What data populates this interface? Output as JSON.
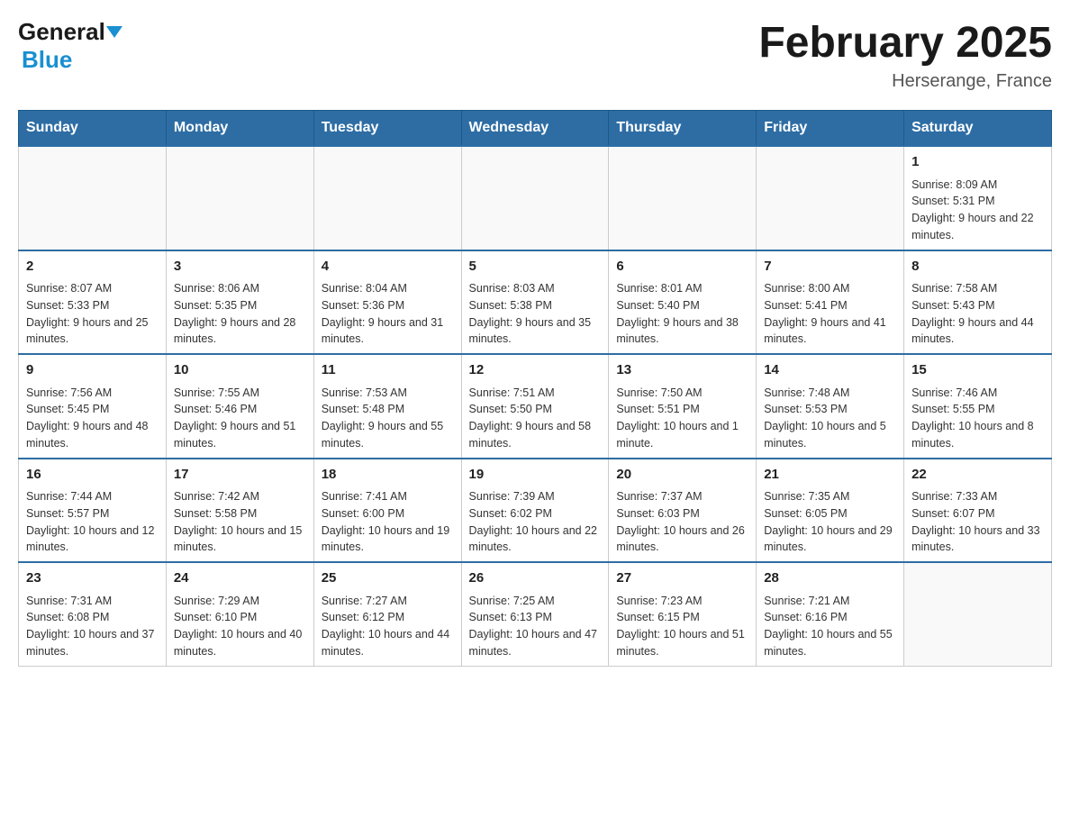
{
  "header": {
    "month_title": "February 2025",
    "location": "Herserange, France",
    "logo_general": "General",
    "logo_blue": "Blue"
  },
  "weekdays": [
    "Sunday",
    "Monday",
    "Tuesday",
    "Wednesday",
    "Thursday",
    "Friday",
    "Saturday"
  ],
  "weeks": [
    {
      "days": [
        {
          "num": "",
          "info": "",
          "empty": true
        },
        {
          "num": "",
          "info": "",
          "empty": true
        },
        {
          "num": "",
          "info": "",
          "empty": true
        },
        {
          "num": "",
          "info": "",
          "empty": true
        },
        {
          "num": "",
          "info": "",
          "empty": true
        },
        {
          "num": "",
          "info": "",
          "empty": true
        },
        {
          "num": "1",
          "info": "Sunrise: 8:09 AM\nSunset: 5:31 PM\nDaylight: 9 hours and 22 minutes.",
          "empty": false
        }
      ]
    },
    {
      "days": [
        {
          "num": "2",
          "info": "Sunrise: 8:07 AM\nSunset: 5:33 PM\nDaylight: 9 hours and 25 minutes.",
          "empty": false
        },
        {
          "num": "3",
          "info": "Sunrise: 8:06 AM\nSunset: 5:35 PM\nDaylight: 9 hours and 28 minutes.",
          "empty": false
        },
        {
          "num": "4",
          "info": "Sunrise: 8:04 AM\nSunset: 5:36 PM\nDaylight: 9 hours and 31 minutes.",
          "empty": false
        },
        {
          "num": "5",
          "info": "Sunrise: 8:03 AM\nSunset: 5:38 PM\nDaylight: 9 hours and 35 minutes.",
          "empty": false
        },
        {
          "num": "6",
          "info": "Sunrise: 8:01 AM\nSunset: 5:40 PM\nDaylight: 9 hours and 38 minutes.",
          "empty": false
        },
        {
          "num": "7",
          "info": "Sunrise: 8:00 AM\nSunset: 5:41 PM\nDaylight: 9 hours and 41 minutes.",
          "empty": false
        },
        {
          "num": "8",
          "info": "Sunrise: 7:58 AM\nSunset: 5:43 PM\nDaylight: 9 hours and 44 minutes.",
          "empty": false
        }
      ]
    },
    {
      "days": [
        {
          "num": "9",
          "info": "Sunrise: 7:56 AM\nSunset: 5:45 PM\nDaylight: 9 hours and 48 minutes.",
          "empty": false
        },
        {
          "num": "10",
          "info": "Sunrise: 7:55 AM\nSunset: 5:46 PM\nDaylight: 9 hours and 51 minutes.",
          "empty": false
        },
        {
          "num": "11",
          "info": "Sunrise: 7:53 AM\nSunset: 5:48 PM\nDaylight: 9 hours and 55 minutes.",
          "empty": false
        },
        {
          "num": "12",
          "info": "Sunrise: 7:51 AM\nSunset: 5:50 PM\nDaylight: 9 hours and 58 minutes.",
          "empty": false
        },
        {
          "num": "13",
          "info": "Sunrise: 7:50 AM\nSunset: 5:51 PM\nDaylight: 10 hours and 1 minute.",
          "empty": false
        },
        {
          "num": "14",
          "info": "Sunrise: 7:48 AM\nSunset: 5:53 PM\nDaylight: 10 hours and 5 minutes.",
          "empty": false
        },
        {
          "num": "15",
          "info": "Sunrise: 7:46 AM\nSunset: 5:55 PM\nDaylight: 10 hours and 8 minutes.",
          "empty": false
        }
      ]
    },
    {
      "days": [
        {
          "num": "16",
          "info": "Sunrise: 7:44 AM\nSunset: 5:57 PM\nDaylight: 10 hours and 12 minutes.",
          "empty": false
        },
        {
          "num": "17",
          "info": "Sunrise: 7:42 AM\nSunset: 5:58 PM\nDaylight: 10 hours and 15 minutes.",
          "empty": false
        },
        {
          "num": "18",
          "info": "Sunrise: 7:41 AM\nSunset: 6:00 PM\nDaylight: 10 hours and 19 minutes.",
          "empty": false
        },
        {
          "num": "19",
          "info": "Sunrise: 7:39 AM\nSunset: 6:02 PM\nDaylight: 10 hours and 22 minutes.",
          "empty": false
        },
        {
          "num": "20",
          "info": "Sunrise: 7:37 AM\nSunset: 6:03 PM\nDaylight: 10 hours and 26 minutes.",
          "empty": false
        },
        {
          "num": "21",
          "info": "Sunrise: 7:35 AM\nSunset: 6:05 PM\nDaylight: 10 hours and 29 minutes.",
          "empty": false
        },
        {
          "num": "22",
          "info": "Sunrise: 7:33 AM\nSunset: 6:07 PM\nDaylight: 10 hours and 33 minutes.",
          "empty": false
        }
      ]
    },
    {
      "days": [
        {
          "num": "23",
          "info": "Sunrise: 7:31 AM\nSunset: 6:08 PM\nDaylight: 10 hours and 37 minutes.",
          "empty": false
        },
        {
          "num": "24",
          "info": "Sunrise: 7:29 AM\nSunset: 6:10 PM\nDaylight: 10 hours and 40 minutes.",
          "empty": false
        },
        {
          "num": "25",
          "info": "Sunrise: 7:27 AM\nSunset: 6:12 PM\nDaylight: 10 hours and 44 minutes.",
          "empty": false
        },
        {
          "num": "26",
          "info": "Sunrise: 7:25 AM\nSunset: 6:13 PM\nDaylight: 10 hours and 47 minutes.",
          "empty": false
        },
        {
          "num": "27",
          "info": "Sunrise: 7:23 AM\nSunset: 6:15 PM\nDaylight: 10 hours and 51 minutes.",
          "empty": false
        },
        {
          "num": "28",
          "info": "Sunrise: 7:21 AM\nSunset: 6:16 PM\nDaylight: 10 hours and 55 minutes.",
          "empty": false
        },
        {
          "num": "",
          "info": "",
          "empty": true
        }
      ]
    }
  ]
}
